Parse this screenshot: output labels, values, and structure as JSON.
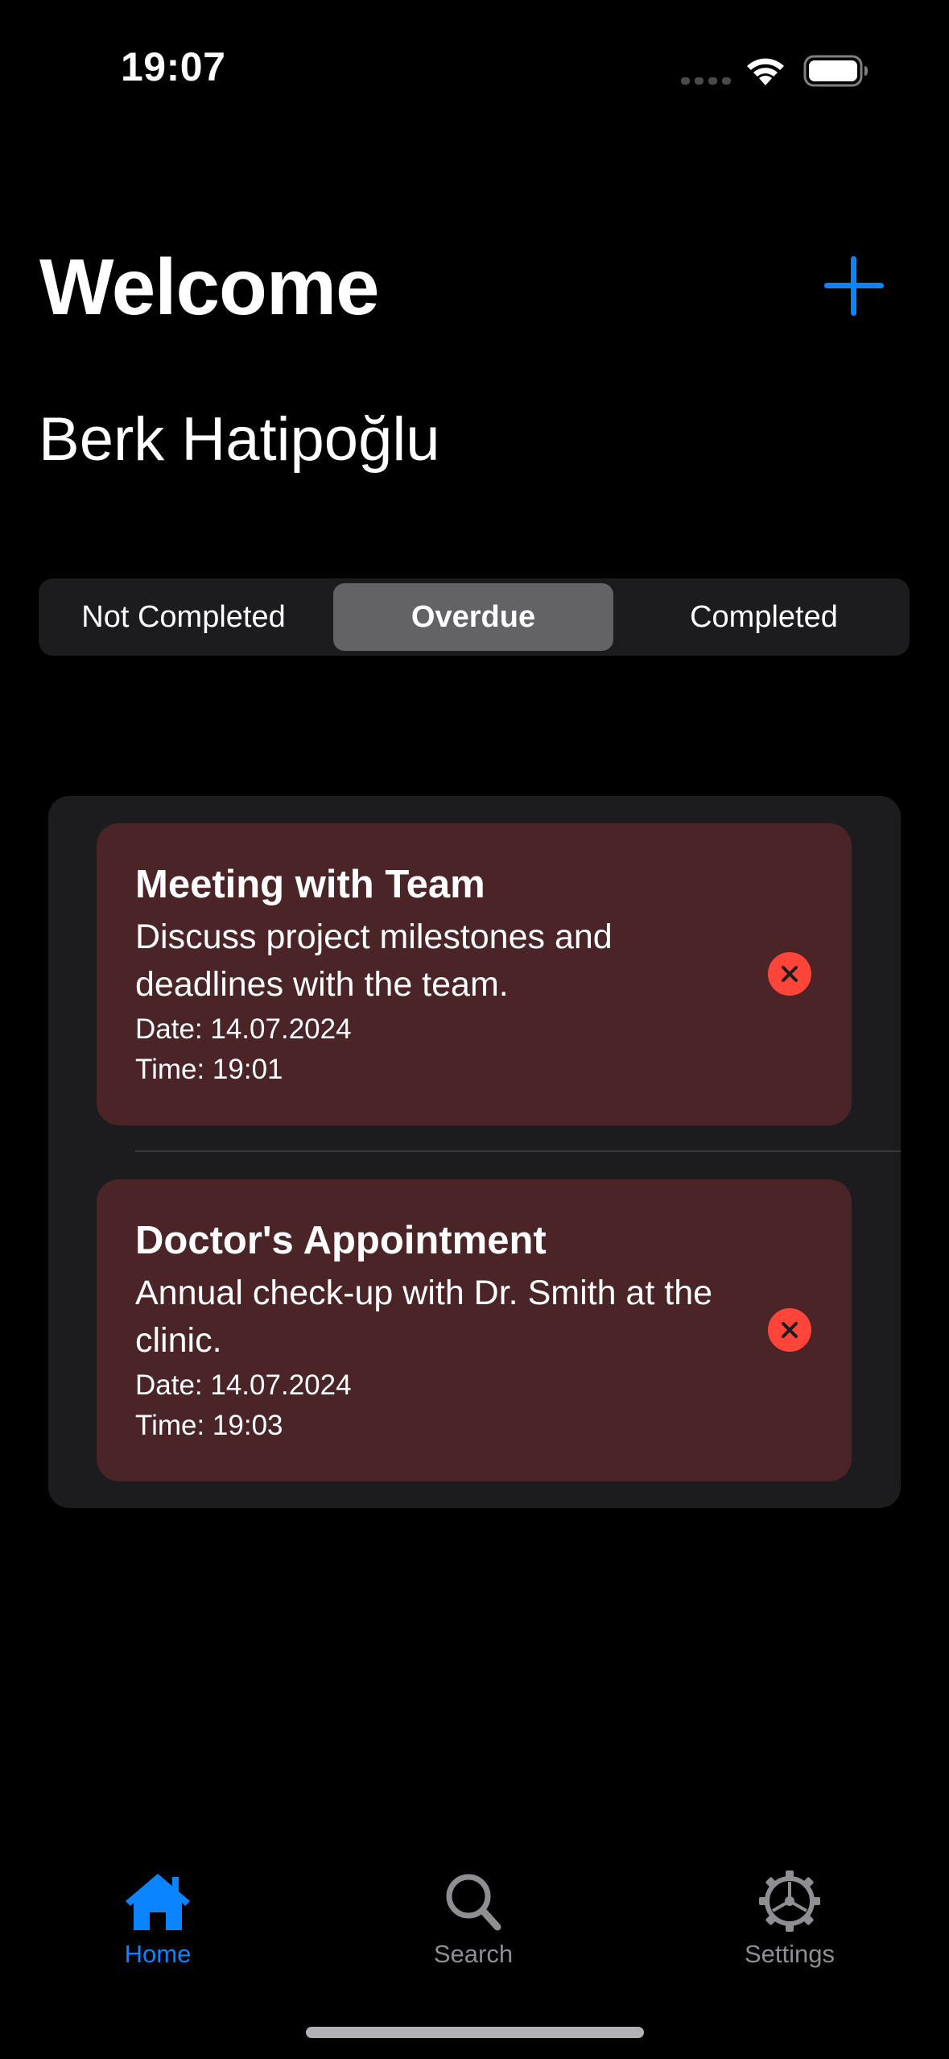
{
  "status_bar": {
    "time": "19:07",
    "wifi_icon": "wifi-icon",
    "battery_icon": "battery-icon"
  },
  "header": {
    "title": "Welcome",
    "user_name": "Berk Hatipoğlu",
    "add_icon": "plus-icon",
    "accent_color": "#0a84ff"
  },
  "segmented_control": {
    "segments": [
      {
        "label": "Not Completed"
      },
      {
        "label": "Overdue"
      },
      {
        "label": "Completed"
      }
    ],
    "selected": "Overdue"
  },
  "tasks": [
    {
      "title": "Meeting with Team",
      "description": "Discuss project milestones and deadlines with the team.",
      "date": "Date: 14.07.2024",
      "time": "Time: 19:01",
      "status_color": "#4a2427",
      "action_icon": "xmark-circle-icon"
    },
    {
      "title": "Doctor's Appointment",
      "description": "Annual check-up with Dr. Smith at the clinic.",
      "date": "Date: 14.07.2024",
      "time": "Time: 19:03",
      "status_color": "#4a2427",
      "action_icon": "xmark-circle-icon"
    }
  ],
  "tab_bar": {
    "items": [
      {
        "label": "Home",
        "icon": "house-fill-icon",
        "active": true
      },
      {
        "label": "Search",
        "icon": "magnifyingglass-icon",
        "active": false
      },
      {
        "label": "Settings",
        "icon": "gear-icon",
        "active": false
      }
    ],
    "active_color": "#0a84ff",
    "inactive_color": "#8e8e93"
  }
}
